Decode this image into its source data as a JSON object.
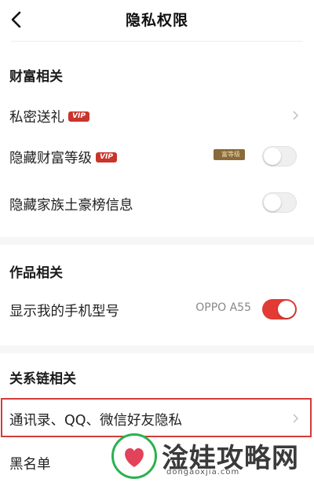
{
  "nav": {
    "title": "隐私权限"
  },
  "sections": {
    "wealth": "财富相关",
    "works": "作品相关",
    "relations": "关系链相关"
  },
  "rows": {
    "private_gift": {
      "label": "私密送礼",
      "badge": "VIP"
    },
    "hide_wealth_level": {
      "label": "隐藏财富等级",
      "badge": "VIP",
      "tag": "富等级",
      "enabled": false
    },
    "hide_family_rank": {
      "label": "隐藏家族土豪榜信息",
      "enabled": false
    },
    "show_phone_model": {
      "label": "显示我的手机型号",
      "value": "OPPO A55",
      "enabled": true
    },
    "contacts_privacy": {
      "label": "通讯录、QQ、微信好友隐私"
    },
    "blacklist": {
      "label": "黑名单"
    }
  },
  "watermark": {
    "text": "淦娃攻略网",
    "url": "dongaoxjia.com"
  },
  "colors": {
    "accent": "#e23a34",
    "vip": "#c9342b",
    "highlight_border": "#d43b3b"
  },
  "icons": [
    "back-icon",
    "chevron-right-icon",
    "toggle-switch"
  ]
}
